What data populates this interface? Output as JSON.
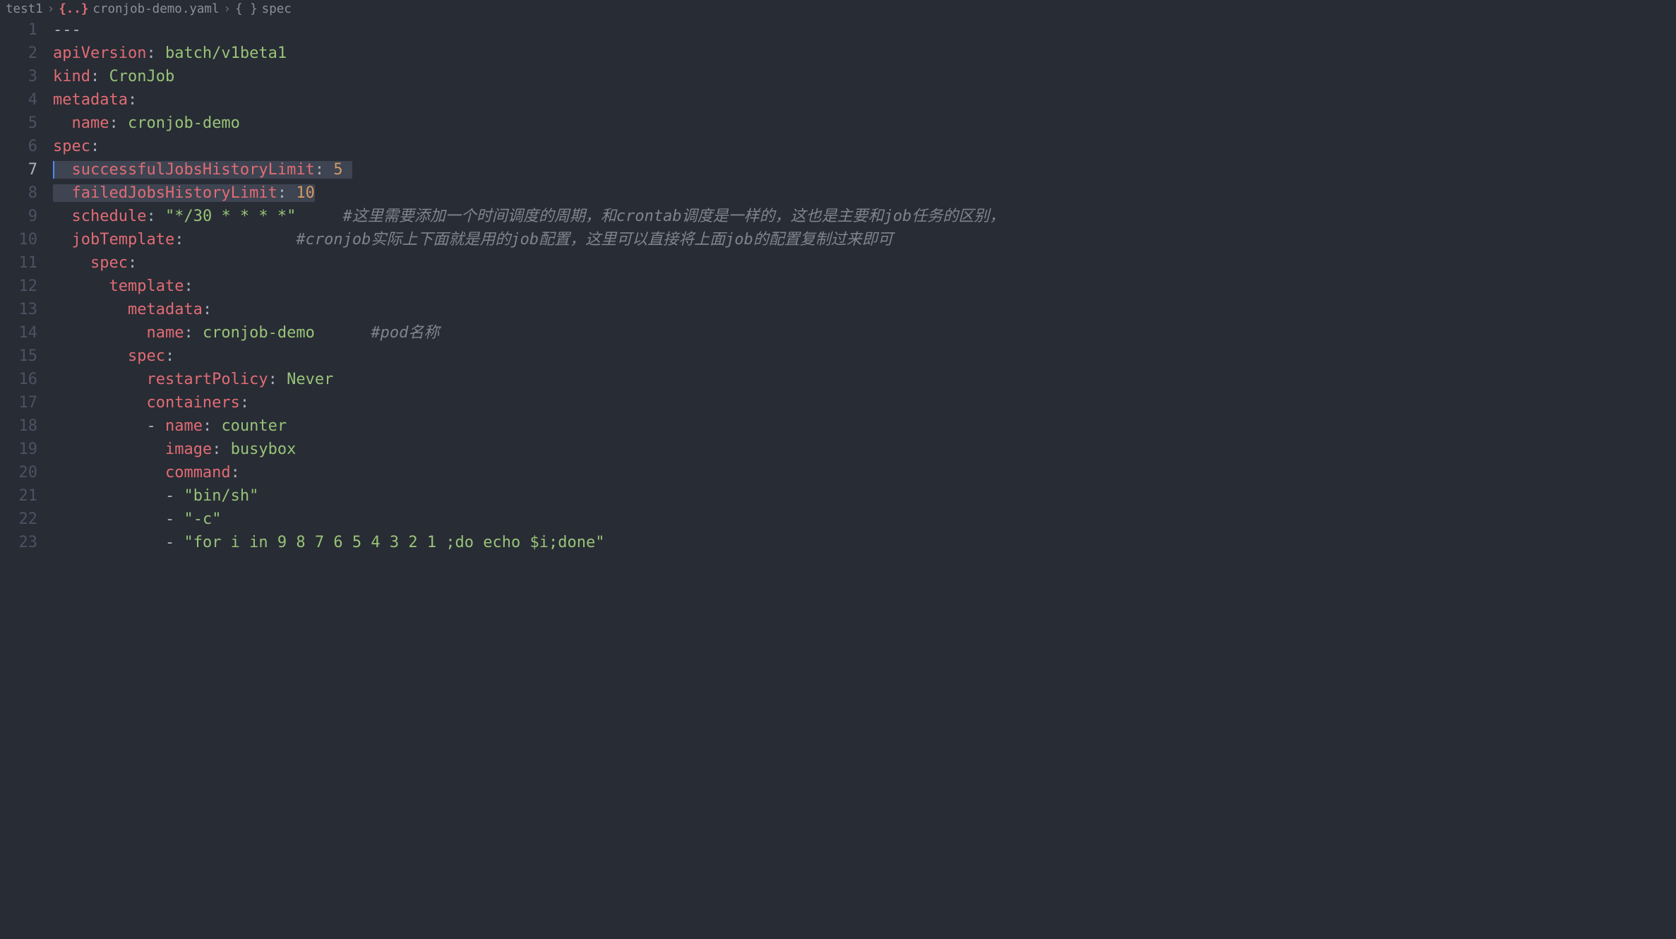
{
  "breadcrumb": {
    "items": [
      {
        "label": "test1",
        "icon": null
      },
      {
        "label": "cronjob-demo.yaml",
        "icon": "yaml-icon",
        "icon_text": "{..}"
      },
      {
        "label": "spec",
        "icon": "braces-icon",
        "icon_text": "{ }"
      }
    ],
    "sep": "›"
  },
  "active_line": 7,
  "lines": [
    {
      "num": 1,
      "tokens": [
        {
          "cls": "doc",
          "t": "---"
        }
      ]
    },
    {
      "num": 2,
      "tokens": [
        {
          "cls": "k",
          "t": "apiVersion"
        },
        {
          "cls": "p",
          "t": ":"
        },
        {
          "cls": "w",
          "t": " "
        },
        {
          "cls": "s",
          "t": "batch/v1beta1"
        }
      ]
    },
    {
      "num": 3,
      "tokens": [
        {
          "cls": "k",
          "t": "kind"
        },
        {
          "cls": "p",
          "t": ":"
        },
        {
          "cls": "w",
          "t": " "
        },
        {
          "cls": "s",
          "t": "CronJob"
        }
      ]
    },
    {
      "num": 4,
      "tokens": [
        {
          "cls": "k",
          "t": "metadata"
        },
        {
          "cls": "p",
          "t": ":"
        }
      ]
    },
    {
      "num": 5,
      "tokens": [
        {
          "cls": "w",
          "t": "  "
        },
        {
          "cls": "k",
          "t": "name"
        },
        {
          "cls": "p",
          "t": ":"
        },
        {
          "cls": "w",
          "t": " "
        },
        {
          "cls": "s",
          "t": "cronjob-demo"
        }
      ]
    },
    {
      "num": 6,
      "tokens": [
        {
          "cls": "k",
          "t": "spec"
        },
        {
          "cls": "p",
          "t": ":"
        }
      ]
    },
    {
      "num": 7,
      "selected": "cursor",
      "tokens": [
        {
          "cls": "w",
          "t": "  "
        },
        {
          "cls": "k",
          "t": "successfulJobsHistoryLimit"
        },
        {
          "cls": "p",
          "t": ":"
        },
        {
          "cls": "w",
          "t": " "
        },
        {
          "cls": "n",
          "t": "5"
        },
        {
          "cls": "w",
          "t": " "
        }
      ]
    },
    {
      "num": 8,
      "selected": "true",
      "tokens": [
        {
          "cls": "w",
          "t": "  "
        },
        {
          "cls": "k",
          "t": "failedJobsHistoryLimit"
        },
        {
          "cls": "p",
          "t": ":"
        },
        {
          "cls": "w",
          "t": " "
        },
        {
          "cls": "n",
          "t": "10"
        }
      ]
    },
    {
      "num": 9,
      "tokens": [
        {
          "cls": "w",
          "t": "  "
        },
        {
          "cls": "k",
          "t": "schedule"
        },
        {
          "cls": "p",
          "t": ":"
        },
        {
          "cls": "w",
          "t": " "
        },
        {
          "cls": "s",
          "t": "\"*/30 * * * *\""
        },
        {
          "cls": "w",
          "t": "     "
        },
        {
          "cls": "c",
          "t": "#这里需要添加一个时间调度的周期，和crontab调度是一样的，这也是主要和job任务的区别，"
        }
      ]
    },
    {
      "num": 10,
      "tokens": [
        {
          "cls": "w",
          "t": "  "
        },
        {
          "cls": "k",
          "t": "jobTemplate"
        },
        {
          "cls": "p",
          "t": ":"
        },
        {
          "cls": "w",
          "t": "            "
        },
        {
          "cls": "c",
          "t": "#cronjob实际上下面就是用的job配置，这里可以直接将上面job的配置复制过来即可"
        }
      ]
    },
    {
      "num": 11,
      "tokens": [
        {
          "cls": "w",
          "t": "    "
        },
        {
          "cls": "k",
          "t": "spec"
        },
        {
          "cls": "p",
          "t": ":"
        }
      ]
    },
    {
      "num": 12,
      "tokens": [
        {
          "cls": "w",
          "t": "      "
        },
        {
          "cls": "k",
          "t": "template"
        },
        {
          "cls": "p",
          "t": ":"
        }
      ]
    },
    {
      "num": 13,
      "tokens": [
        {
          "cls": "w",
          "t": "        "
        },
        {
          "cls": "k",
          "t": "metadata"
        },
        {
          "cls": "p",
          "t": ":"
        }
      ]
    },
    {
      "num": 14,
      "tokens": [
        {
          "cls": "w",
          "t": "          "
        },
        {
          "cls": "k",
          "t": "name"
        },
        {
          "cls": "p",
          "t": ":"
        },
        {
          "cls": "w",
          "t": " "
        },
        {
          "cls": "s",
          "t": "cronjob-demo"
        },
        {
          "cls": "w",
          "t": "      "
        },
        {
          "cls": "c",
          "t": "#pod名称"
        }
      ]
    },
    {
      "num": 15,
      "tokens": [
        {
          "cls": "w",
          "t": "        "
        },
        {
          "cls": "k",
          "t": "spec"
        },
        {
          "cls": "p",
          "t": ":"
        }
      ]
    },
    {
      "num": 16,
      "tokens": [
        {
          "cls": "w",
          "t": "          "
        },
        {
          "cls": "k",
          "t": "restartPolicy"
        },
        {
          "cls": "p",
          "t": ":"
        },
        {
          "cls": "w",
          "t": " "
        },
        {
          "cls": "s",
          "t": "Never"
        }
      ]
    },
    {
      "num": 17,
      "tokens": [
        {
          "cls": "w",
          "t": "          "
        },
        {
          "cls": "k",
          "t": "containers"
        },
        {
          "cls": "p",
          "t": ":"
        }
      ]
    },
    {
      "num": 18,
      "tokens": [
        {
          "cls": "w",
          "t": "          "
        },
        {
          "cls": "dash",
          "t": "- "
        },
        {
          "cls": "k",
          "t": "name"
        },
        {
          "cls": "p",
          "t": ":"
        },
        {
          "cls": "w",
          "t": " "
        },
        {
          "cls": "s",
          "t": "counter"
        }
      ]
    },
    {
      "num": 19,
      "tokens": [
        {
          "cls": "w",
          "t": "            "
        },
        {
          "cls": "k",
          "t": "image"
        },
        {
          "cls": "p",
          "t": ":"
        },
        {
          "cls": "w",
          "t": " "
        },
        {
          "cls": "s",
          "t": "busybox"
        }
      ]
    },
    {
      "num": 20,
      "tokens": [
        {
          "cls": "w",
          "t": "            "
        },
        {
          "cls": "k",
          "t": "command"
        },
        {
          "cls": "p",
          "t": ":"
        }
      ]
    },
    {
      "num": 21,
      "tokens": [
        {
          "cls": "w",
          "t": "            "
        },
        {
          "cls": "dash",
          "t": "- "
        },
        {
          "cls": "s",
          "t": "\"bin/sh\""
        }
      ]
    },
    {
      "num": 22,
      "tokens": [
        {
          "cls": "w",
          "t": "            "
        },
        {
          "cls": "dash",
          "t": "- "
        },
        {
          "cls": "s",
          "t": "\"-c\""
        }
      ]
    },
    {
      "num": 23,
      "tokens": [
        {
          "cls": "w",
          "t": "            "
        },
        {
          "cls": "dash",
          "t": "- "
        },
        {
          "cls": "s",
          "t": "\"for i in 9 8 7 6 5 4 3 2 1 ;do echo $i;done\""
        }
      ]
    }
  ]
}
